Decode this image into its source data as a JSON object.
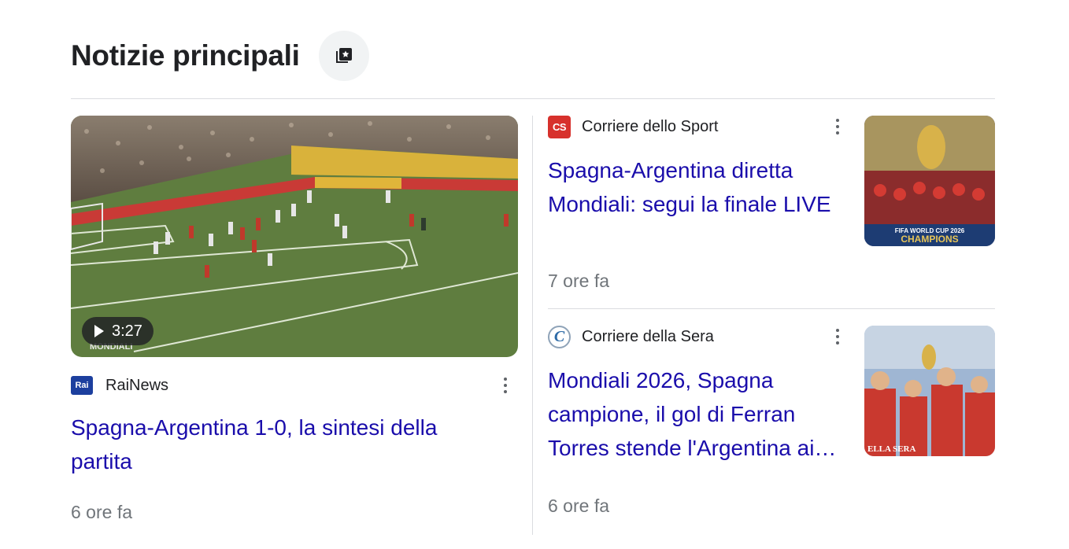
{
  "header": {
    "title": "Notizie principali",
    "button_icon": "stacked-star-icon"
  },
  "main_story": {
    "video_duration": "3:27",
    "source": "RaiNews",
    "source_logo_text": "Rai",
    "headline": "Spagna-Argentina 1-0, la sintesi della partita",
    "time": "6 ore fa",
    "thumb_watermark": "MONDIALI"
  },
  "side_stories": [
    {
      "source": "Corriere dello Sport",
      "source_logo_text": "CS",
      "headline": "Spagna-Argentina diretta Mondiali: segui la finale LIVE",
      "time": "7 ore fa",
      "thumb_caption_1": "FIFA WORLD CUP 2026",
      "thumb_caption_2": "CHAMPIONS"
    },
    {
      "source": "Corriere della Sera",
      "source_logo_text": "C",
      "headline": "Mondiali 2026, Spagna campione, il gol di Ferran Torres stende l'Argentina ai…",
      "time": "6 ore fa",
      "thumb_caption_1": "ELLA SERA"
    }
  ],
  "colors": {
    "link": "#1a0dab",
    "meta": "#70757a",
    "divider": "#dadce0"
  }
}
